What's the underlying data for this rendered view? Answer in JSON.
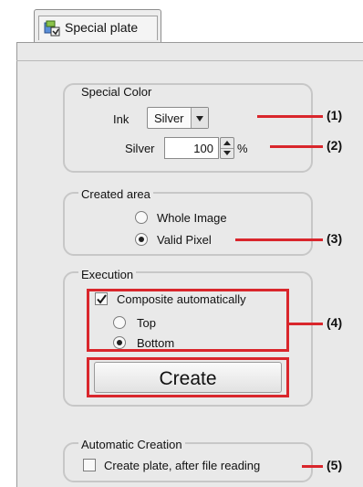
{
  "tab": {
    "label": "Special plate",
    "icon": "special-plate-icon"
  },
  "special_color": {
    "title": "Special Color",
    "ink_label": "Ink",
    "ink_value": "Silver",
    "amount_label": "Silver",
    "amount_value": "100",
    "amount_unit": "%"
  },
  "created_area": {
    "title": "Created area",
    "options": [
      "Whole Image",
      "Valid Pixel"
    ],
    "selected": "Valid Pixel"
  },
  "execution": {
    "title": "Execution",
    "composite_label": "Composite automatically",
    "composite_checked": true,
    "position_options": [
      "Top",
      "Bottom"
    ],
    "position_selected": "Bottom",
    "create_label": "Create"
  },
  "automatic_creation": {
    "title": "Automatic Creation",
    "checkbox_label": "Create plate, after file reading",
    "checked": false
  },
  "callouts": [
    "(1)",
    "(2)",
    "(3)",
    "(4)",
    "(5)"
  ],
  "colors": {
    "highlight": "#d9262c",
    "panel": "#e9e9e9"
  }
}
